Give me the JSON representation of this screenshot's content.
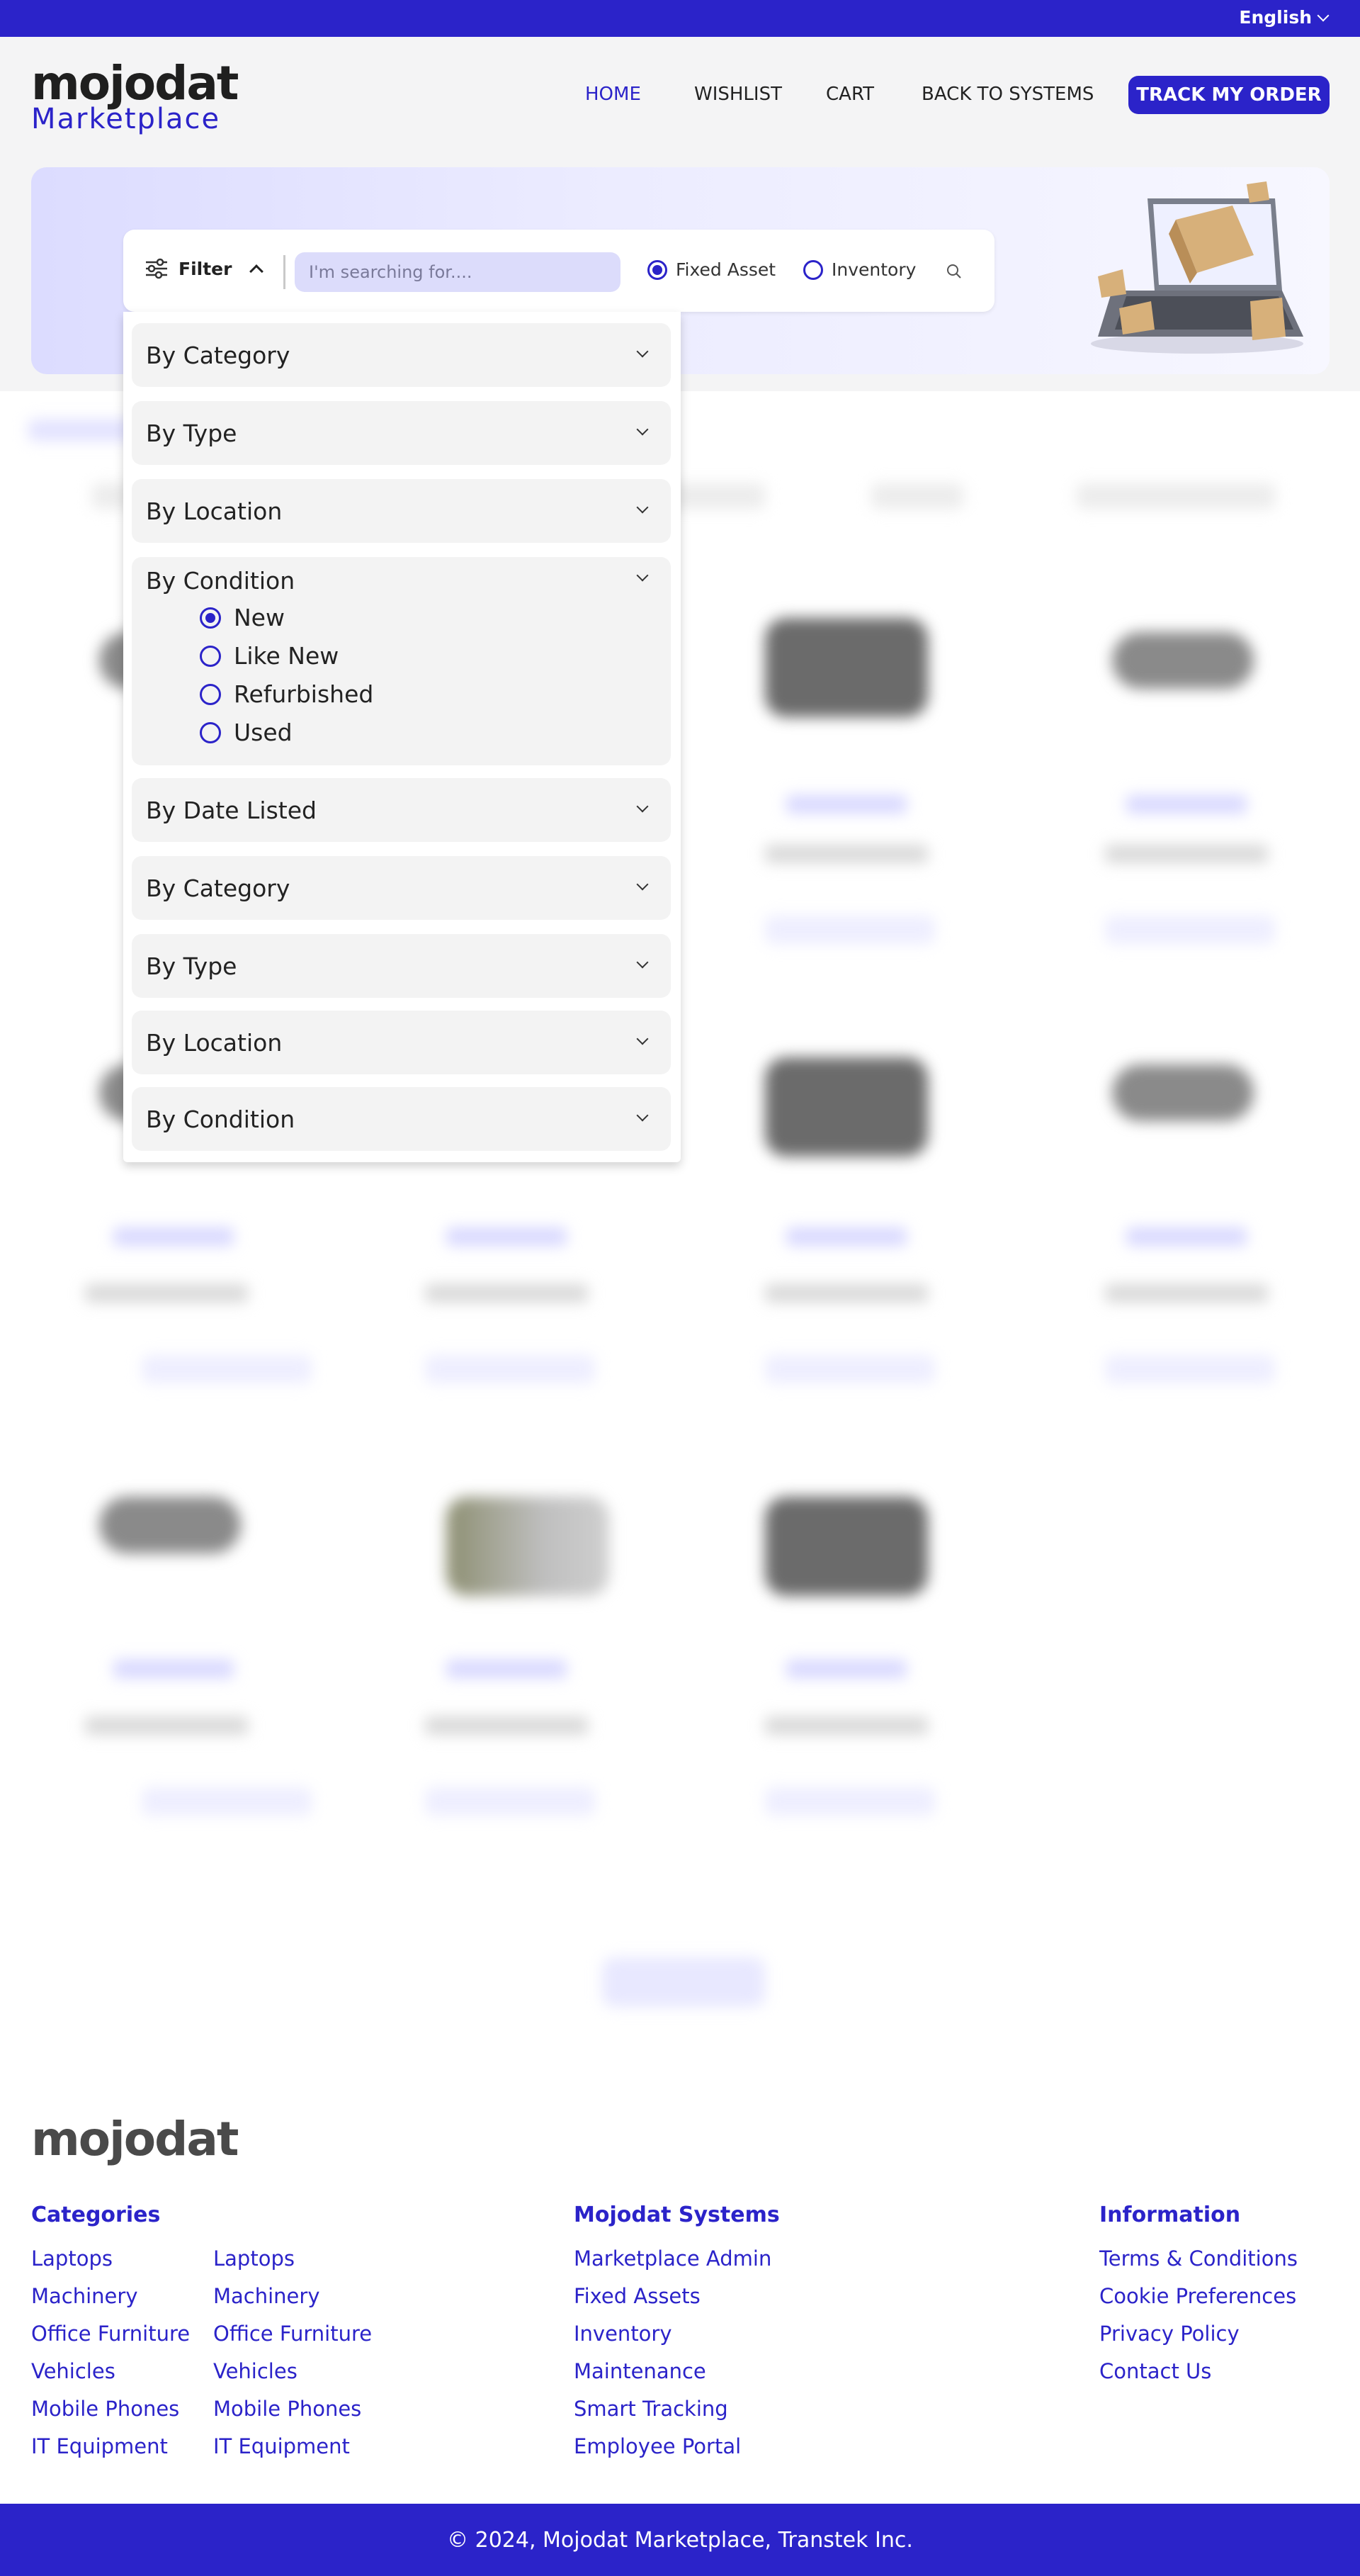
{
  "topbar": {
    "language": "English"
  },
  "brand": {
    "name": "mojodat",
    "sub": "Marketplace",
    "accent": "#2b23c9"
  },
  "nav": {
    "home": "HOME",
    "wishlist": "WISHLIST",
    "cart": "CART",
    "back": "BACK TO SYSTEMS",
    "track": "TRACK MY ORDER"
  },
  "search": {
    "filter_label": "Filter",
    "placeholder": "I'm searching for....",
    "value": "",
    "mode_options": [
      "Fixed Asset",
      "Inventory"
    ],
    "mode_selected": "Fixed Asset"
  },
  "filters": {
    "groups": [
      "By Category",
      "By Type",
      "By Location",
      "By Condition",
      "By Date Listed",
      "By Category",
      "By Type",
      "By Location",
      "By Condition"
    ],
    "expanded": "By Condition",
    "condition_options": [
      "New",
      "Like New",
      "Refurbished",
      "Used"
    ],
    "condition_selected": "New"
  },
  "footer": {
    "logo": "mojodat",
    "categories_title": "Categories",
    "categories_col1": [
      "Laptops",
      "Machinery",
      "Office Furniture",
      "Vehicles",
      "Mobile Phones",
      "IT Equipment"
    ],
    "categories_col2": [
      "Laptops",
      "Machinery",
      "Office Furniture",
      "Vehicles",
      "Mobile Phones",
      "IT Equipment"
    ],
    "systems_title": "Mojodat Systems",
    "systems": [
      "Marketplace Admin",
      "Fixed Assets",
      "Inventory",
      "Maintenance",
      "Smart Tracking",
      "Employee Portal"
    ],
    "info_title": "Information",
    "info": [
      "Terms & Conditions",
      "Cookie Preferences",
      "Privacy Policy",
      "Contact Us"
    ],
    "copyright": "© 2024, Mojodat Marketplace, Transtek Inc."
  }
}
